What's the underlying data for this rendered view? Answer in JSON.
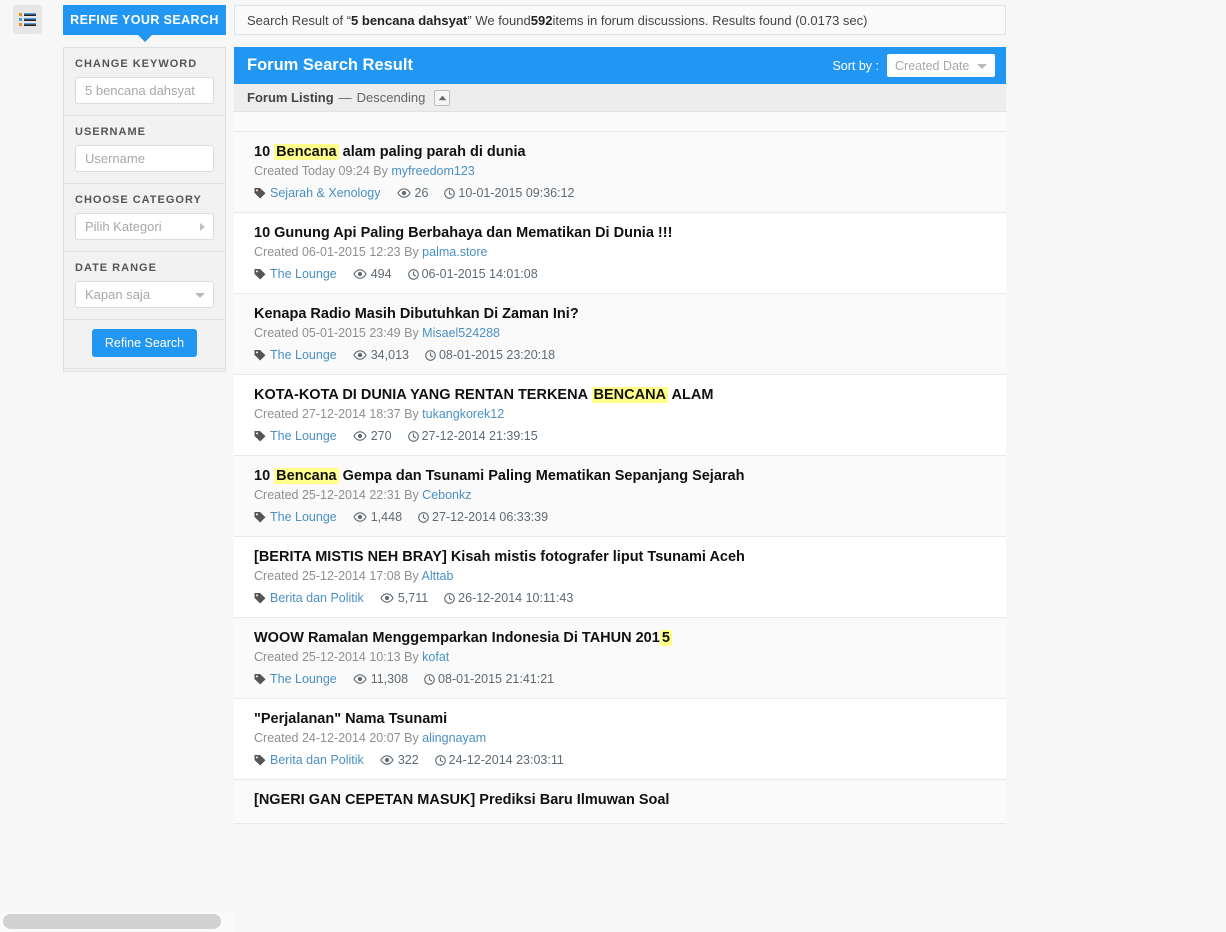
{
  "topbar": {
    "menu_icon": "list-icon",
    "refine_tab_label": "REFINE YOUR SEARCH",
    "summary_prefix": "Search Result of “",
    "summary_query": "5 bencana dahsyat",
    "summary_mid": "” We found ",
    "summary_count": "592",
    "summary_suffix": " items in forum discussions. Results found (0.0173 sec)"
  },
  "sidebar": {
    "filters": [
      {
        "label": "CHANGE KEYWORD",
        "type": "text",
        "value": "",
        "placeholder": "5 bencana dahsyat",
        "name": "keyword"
      },
      {
        "label": "USERNAME",
        "type": "text",
        "value": "",
        "placeholder": "Username",
        "name": "username"
      },
      {
        "label": "CHOOSE CATEGORY",
        "type": "select-right",
        "value": "Pilih Kategori",
        "name": "category"
      },
      {
        "label": "DATE RANGE",
        "type": "select-down",
        "value": "Kapan saja",
        "name": "date-range"
      }
    ],
    "submit_label": "Refine Search"
  },
  "content": {
    "title": "Forum Search Result",
    "sort_label": "Sort by :",
    "sort_value": "Created Date",
    "sort_caret_icon": "chevron-down-icon",
    "listing_label": "Forum Listing",
    "listing_dash": "—",
    "listing_order": "Descending",
    "sort_dir_icon": "chevron-up-icon"
  },
  "colors": {
    "accent": "#2196f3",
    "highlight": "#ffff8a",
    "link": "#4a90c4",
    "page_bg": "#f7f7f7"
  },
  "icons": {
    "tag": "tag-icon",
    "eye": "eye-icon",
    "clock": "clock-icon"
  },
  "results": [
    {
      "title_parts": [
        {
          "t": "10 ",
          "h": false
        },
        {
          "t": "Bencana",
          "h": true
        },
        {
          "t": " alam paling parah di dunia",
          "h": false
        }
      ],
      "created": "Created Today 09:24 By ",
      "author": "myfreedom123",
      "category": "Sejarah & Xenology",
      "views": "26",
      "date": "10-01-2015 09:36:12"
    },
    {
      "title_parts": [
        {
          "t": "10 Gunung Api Paling Berbahaya dan Mematikan Di Dunia !!!",
          "h": false
        }
      ],
      "created": "Created 06-01-2015 12:23 By ",
      "author": "palma.store",
      "category": "The Lounge",
      "views": "494",
      "date": "06-01-2015 14:01:08"
    },
    {
      "title_parts": [
        {
          "t": "Kenapa Radio Masih Dibutuhkan Di Zaman Ini?",
          "h": false
        }
      ],
      "created": "Created 05-01-2015 23:49 By ",
      "author": "Misael524288",
      "category": "The Lounge",
      "views": "34,013",
      "date": "08-01-2015 23:20:18"
    },
    {
      "title_parts": [
        {
          "t": "KOTA-KOTA DI DUNIA YANG RENTAN TERKENA ",
          "h": false
        },
        {
          "t": "BENCANA",
          "h": true
        },
        {
          "t": " ALAM",
          "h": false
        }
      ],
      "created": "Created 27-12-2014 18:37 By ",
      "author": "tukangkorek12",
      "category": "The Lounge",
      "views": "270",
      "date": "27-12-2014 21:39:15"
    },
    {
      "title_parts": [
        {
          "t": "10 ",
          "h": false
        },
        {
          "t": "Bencana",
          "h": true
        },
        {
          "t": " Gempa dan Tsunami Paling Mematikan Sepanjang Sejarah",
          "h": false
        }
      ],
      "created": "Created 25-12-2014 22:31 By ",
      "author": "Cebonkz",
      "category": "The Lounge",
      "views": "1,448",
      "date": "27-12-2014 06:33:39"
    },
    {
      "title_parts": [
        {
          "t": "[BERITA MISTIS NEH BRAY] Kisah mistis fotografer liput Tsunami Aceh",
          "h": false
        }
      ],
      "created": "Created 25-12-2014 17:08 By ",
      "author": "Alttab",
      "category": "Berita dan Politik",
      "views": "5,711",
      "date": "26-12-2014 10:11:43"
    },
    {
      "title_parts": [
        {
          "t": "WOOW Ramalan Menggemparkan Indonesia Di TAHUN 201",
          "h": false
        },
        {
          "t": "5",
          "h": true
        }
      ],
      "created": "Created 25-12-2014 10:13 By ",
      "author": "kofat",
      "category": "The Lounge",
      "views": "11,308",
      "date": "08-01-2015 21:41:21"
    },
    {
      "title_parts": [
        {
          "t": "\"Perjalanan\" Nama Tsunami",
          "h": false
        }
      ],
      "created": "Created 24-12-2014 20:07 By ",
      "author": "alingnayam",
      "category": "Berita dan Politik",
      "views": "322",
      "date": "24-12-2014 23:03:11"
    },
    {
      "title_parts": [
        {
          "t": "[NGERI GAN CEPETAN MASUK] Prediksi Baru Ilmuwan Soal",
          "h": false
        }
      ],
      "created": "",
      "author": "",
      "category": "",
      "views": "",
      "date": "",
      "clipped": true
    }
  ]
}
